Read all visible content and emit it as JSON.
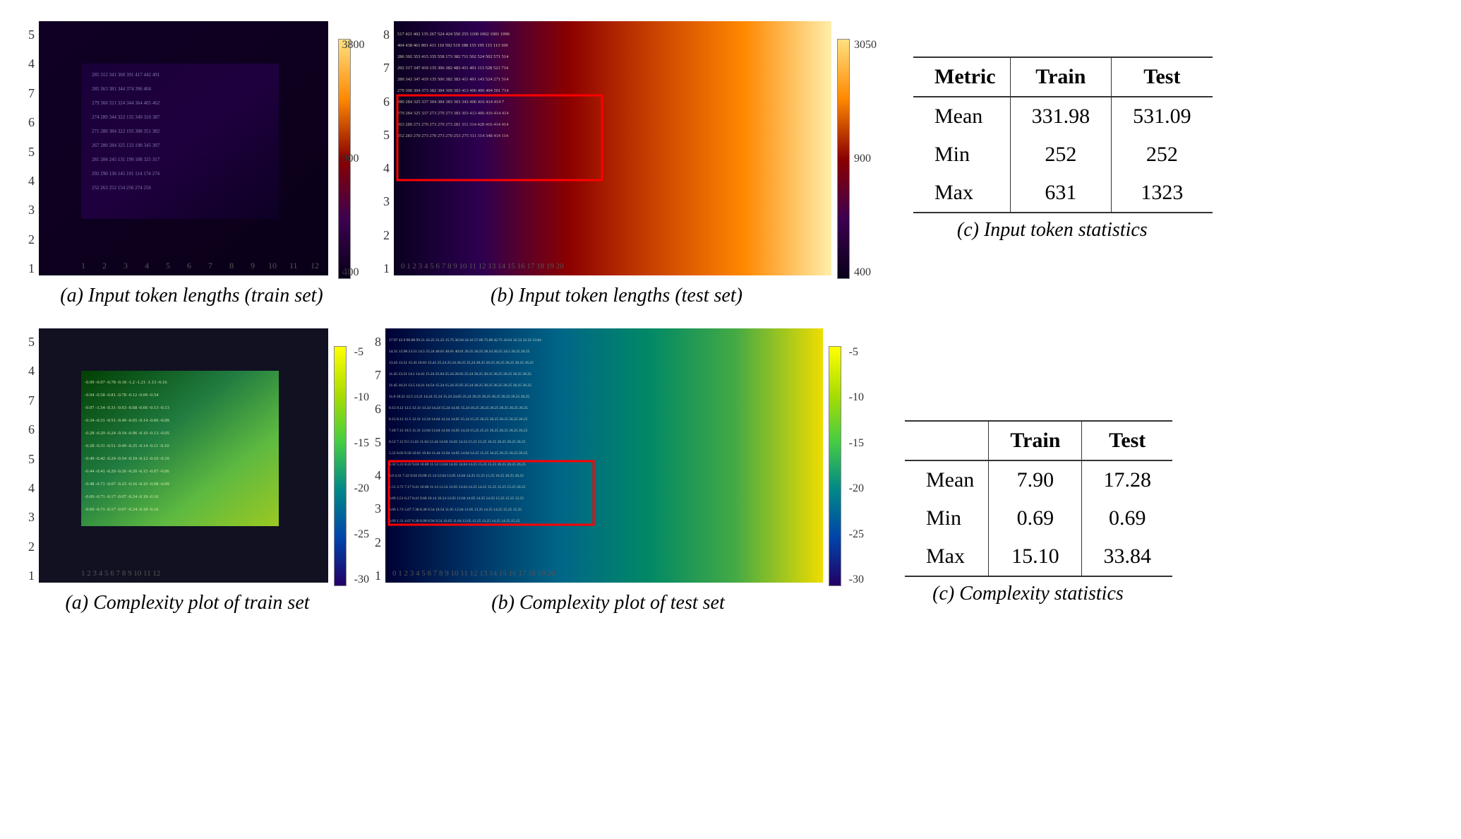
{
  "top": {
    "figures": [
      {
        "id": "fig-a-top",
        "caption": "(a) Input token lengths (train set)"
      },
      {
        "id": "fig-b-top",
        "caption": "(b) Input token lengths (test set)"
      },
      {
        "id": "fig-c-top",
        "caption": "(c) Input token statistics"
      }
    ],
    "colorbar_top": {
      "max": "3800",
      "mid1": "",
      "mid2": "900",
      "mid3": "",
      "min": "400"
    },
    "table": {
      "headers": [
        "Metric",
        "Train",
        "Test"
      ],
      "rows": [
        [
          "Mean",
          "331.98",
          "531.09"
        ],
        [
          "Min",
          "252",
          "252"
        ],
        [
          "Max",
          "631",
          "1323"
        ]
      ]
    }
  },
  "bottom": {
    "figures": [
      {
        "id": "fig-a-bottom",
        "caption": "(a) Complexity plot of train set"
      },
      {
        "id": "fig-b-bottom",
        "caption": "(b) Complexity plot of test set"
      },
      {
        "id": "fig-c-bottom",
        "caption": "(c) Complexity statistics"
      }
    ],
    "colorbar_bottom": {
      "max": "-5",
      "mid1": "-10",
      "mid2": "-15",
      "mid3": "-20",
      "mid4": "-25",
      "min": "-30"
    },
    "table": {
      "headers": [
        "",
        "Train",
        "Test"
      ],
      "rows": [
        [
          "Mean",
          "7.90",
          "17.28"
        ],
        [
          "Min",
          "0.69",
          "0.69"
        ],
        [
          "Max",
          "15.10",
          "33.84"
        ]
      ]
    }
  }
}
